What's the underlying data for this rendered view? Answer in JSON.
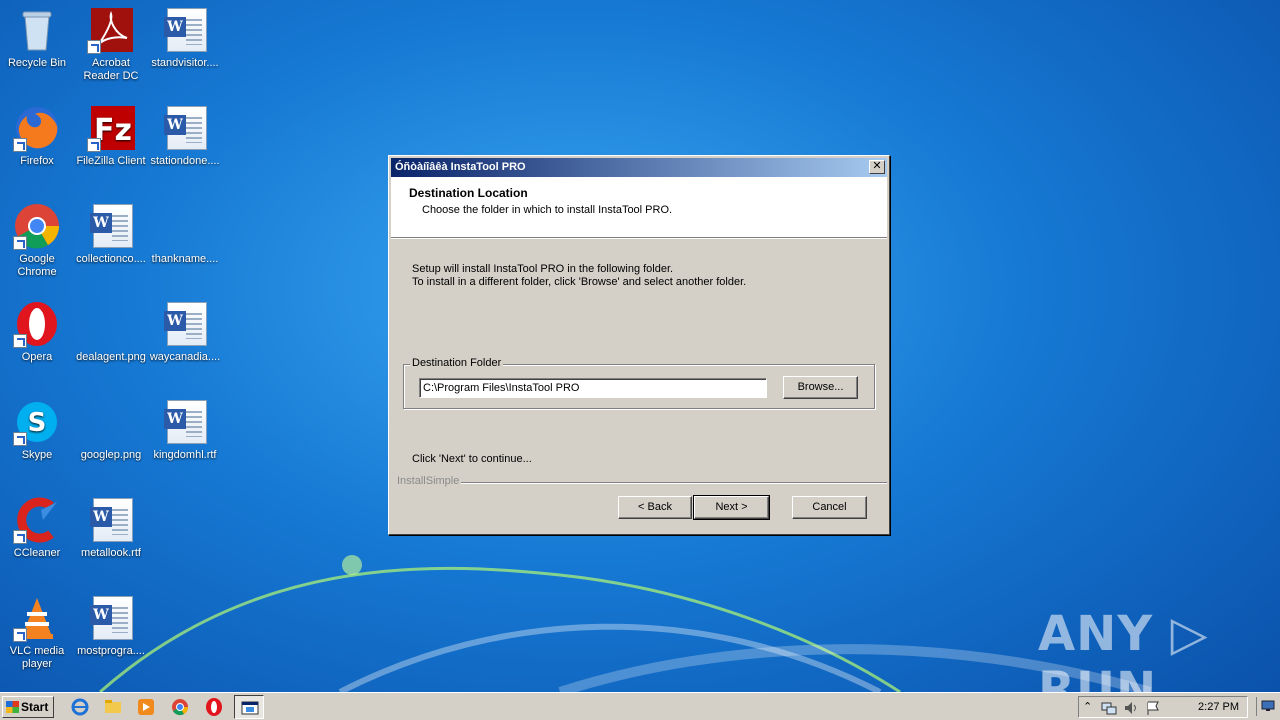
{
  "desktop": {
    "icons": [
      {
        "label": "Recycle Bin",
        "icon": "recycle-bin-icon"
      },
      {
        "label": "Acrobat Reader DC",
        "icon": "acrobat-reader-icon"
      },
      {
        "label": "standvisitor....",
        "icon": "word-document-icon"
      },
      {
        "label": "Firefox",
        "icon": "firefox-icon"
      },
      {
        "label": "FileZilla Client",
        "icon": "filezilla-icon"
      },
      {
        "label": "stationdone....",
        "icon": "word-document-icon"
      },
      {
        "label": "Google Chrome",
        "icon": "chrome-icon"
      },
      {
        "label": "collectionco....",
        "icon": "word-document-icon"
      },
      {
        "label": "thankname....",
        "icon": "blank-image-icon"
      },
      {
        "label": "Opera",
        "icon": "opera-icon"
      },
      {
        "label": "dealagent.png",
        "icon": "blank-image-icon"
      },
      {
        "label": "waycanadia....",
        "icon": "word-document-icon"
      },
      {
        "label": "Skype",
        "icon": "skype-icon"
      },
      {
        "label": "googlep.png",
        "icon": "blank-image-icon"
      },
      {
        "label": "kingdomhl.rtf",
        "icon": "word-document-icon"
      },
      {
        "label": "CCleaner",
        "icon": "ccleaner-icon"
      },
      {
        "label": "metallook.rtf",
        "icon": "word-document-icon"
      },
      {
        "label": "VLC media player",
        "icon": "vlc-icon"
      },
      {
        "label": "mostprogra....",
        "icon": "word-document-icon"
      }
    ]
  },
  "dialog": {
    "title": "Óñòàíîâêà InstaTool PRO",
    "close_glyph": "✕",
    "header_title": "Destination Location",
    "header_subtitle": "Choose the folder in which to install InstaTool PRO.",
    "info_line1": "Setup will install InstaTool PRO in the following folder.",
    "info_line2": "To install in a different folder, click 'Browse' and select another folder.",
    "group_label": "Destination Folder",
    "path_value": "C:\\Program Files\\InstaTool PRO",
    "browse_label": "Browse...",
    "continue_text": "Click 'Next' to continue...",
    "brand": "InstallSimple",
    "back_label": "< Back",
    "next_label": "Next >",
    "cancel_label": "Cancel"
  },
  "taskbar": {
    "start_label": "Start",
    "clock": "2:27 PM"
  },
  "watermark": "ANY ▷ RUN",
  "colors": {
    "titlebar_start": "#0a246a",
    "titlebar_end": "#a6caf0",
    "dialog_face": "#d4d0c8",
    "desktop_blue": "#1679d4"
  }
}
